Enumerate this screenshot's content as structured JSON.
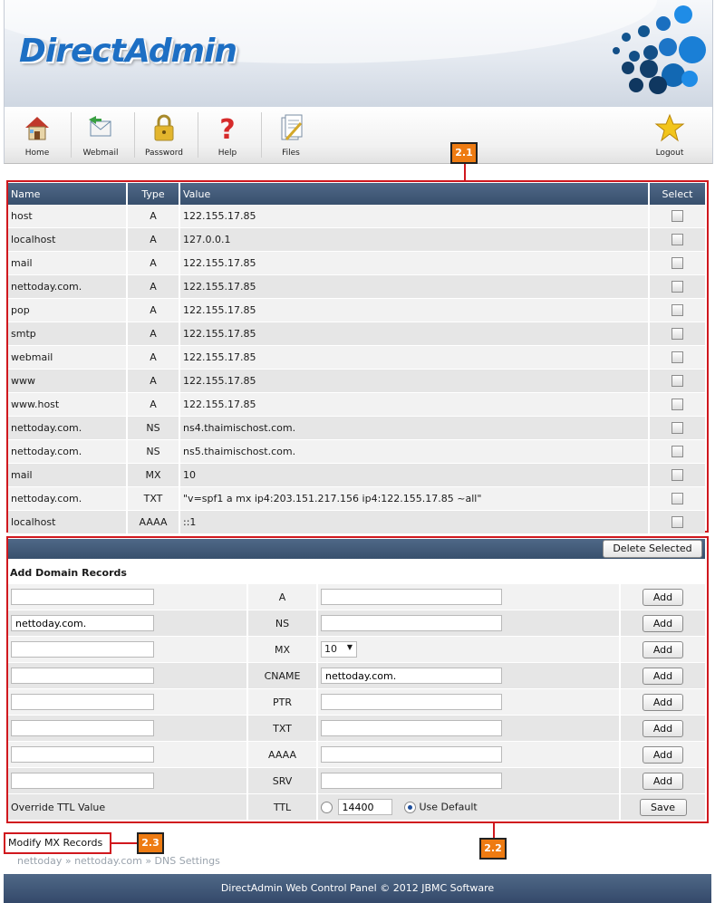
{
  "header": {
    "logo_text": "DirectAdmin"
  },
  "nav": {
    "items": [
      {
        "label": "Home",
        "icon": "home-icon"
      },
      {
        "label": "Webmail",
        "icon": "webmail-icon"
      },
      {
        "label": "Password",
        "icon": "lock-icon"
      },
      {
        "label": "Help",
        "icon": "help-icon"
      },
      {
        "label": "Files",
        "icon": "files-icon"
      },
      {
        "label": "Logout",
        "icon": "star-icon"
      }
    ]
  },
  "annotations": {
    "tag_1": "2.1",
    "tag_2": "2.2",
    "tag_3": "2.3"
  },
  "records": {
    "headers": {
      "name": "Name",
      "type": "Type",
      "value": "Value",
      "select": "Select"
    },
    "rows": [
      {
        "name": "host",
        "type": "A",
        "value": "122.155.17.85"
      },
      {
        "name": "localhost",
        "type": "A",
        "value": "127.0.0.1"
      },
      {
        "name": "mail",
        "type": "A",
        "value": "122.155.17.85"
      },
      {
        "name": "nettoday.com.",
        "type": "A",
        "value": "122.155.17.85"
      },
      {
        "name": "pop",
        "type": "A",
        "value": "122.155.17.85"
      },
      {
        "name": "smtp",
        "type": "A",
        "value": "122.155.17.85"
      },
      {
        "name": "webmail",
        "type": "A",
        "value": "122.155.17.85"
      },
      {
        "name": "www",
        "type": "A",
        "value": "122.155.17.85"
      },
      {
        "name": "www.host",
        "type": "A",
        "value": "122.155.17.85"
      },
      {
        "name": "nettoday.com.",
        "type": "NS",
        "value": "ns4.thaimischost.com."
      },
      {
        "name": "nettoday.com.",
        "type": "NS",
        "value": "ns5.thaimischost.com."
      },
      {
        "name": "mail",
        "type": "MX",
        "value": "10"
      },
      {
        "name": "nettoday.com.",
        "type": "TXT",
        "value": "\"v=spf1 a mx ip4:203.151.217.156 ip4:122.155.17.85 ~all\""
      },
      {
        "name": "localhost",
        "type": "AAAA",
        "value": "::1"
      }
    ]
  },
  "add": {
    "delete_label": "Delete Selected",
    "title": "Add Domain Records",
    "add_label": "Add",
    "rows": [
      {
        "name_value": "",
        "type": "A",
        "value": ""
      },
      {
        "name_value": "nettoday.com.",
        "type": "NS",
        "value": ""
      },
      {
        "name_value": "",
        "type": "MX",
        "value": "10"
      },
      {
        "name_value": "",
        "type": "CNAME",
        "value": "nettoday.com."
      },
      {
        "name_value": "",
        "type": "PTR",
        "value": ""
      },
      {
        "name_value": "",
        "type": "TXT",
        "value": ""
      },
      {
        "name_value": "",
        "type": "AAAA",
        "value": ""
      },
      {
        "name_value": "",
        "type": "SRV",
        "value": ""
      }
    ],
    "ttl": {
      "label": "Override TTL Value",
      "type": "TTL",
      "value": "14400",
      "use_default_label": "Use Default",
      "save_label": "Save"
    }
  },
  "modify_mx": "Modify MX Records",
  "breadcrumb": {
    "item1": "nettoday",
    "item2": "nettoday.com",
    "item3": "DNS Settings",
    "sep": "»"
  },
  "footer": "DirectAdmin Web Control Panel © 2012 JBMC Software"
}
